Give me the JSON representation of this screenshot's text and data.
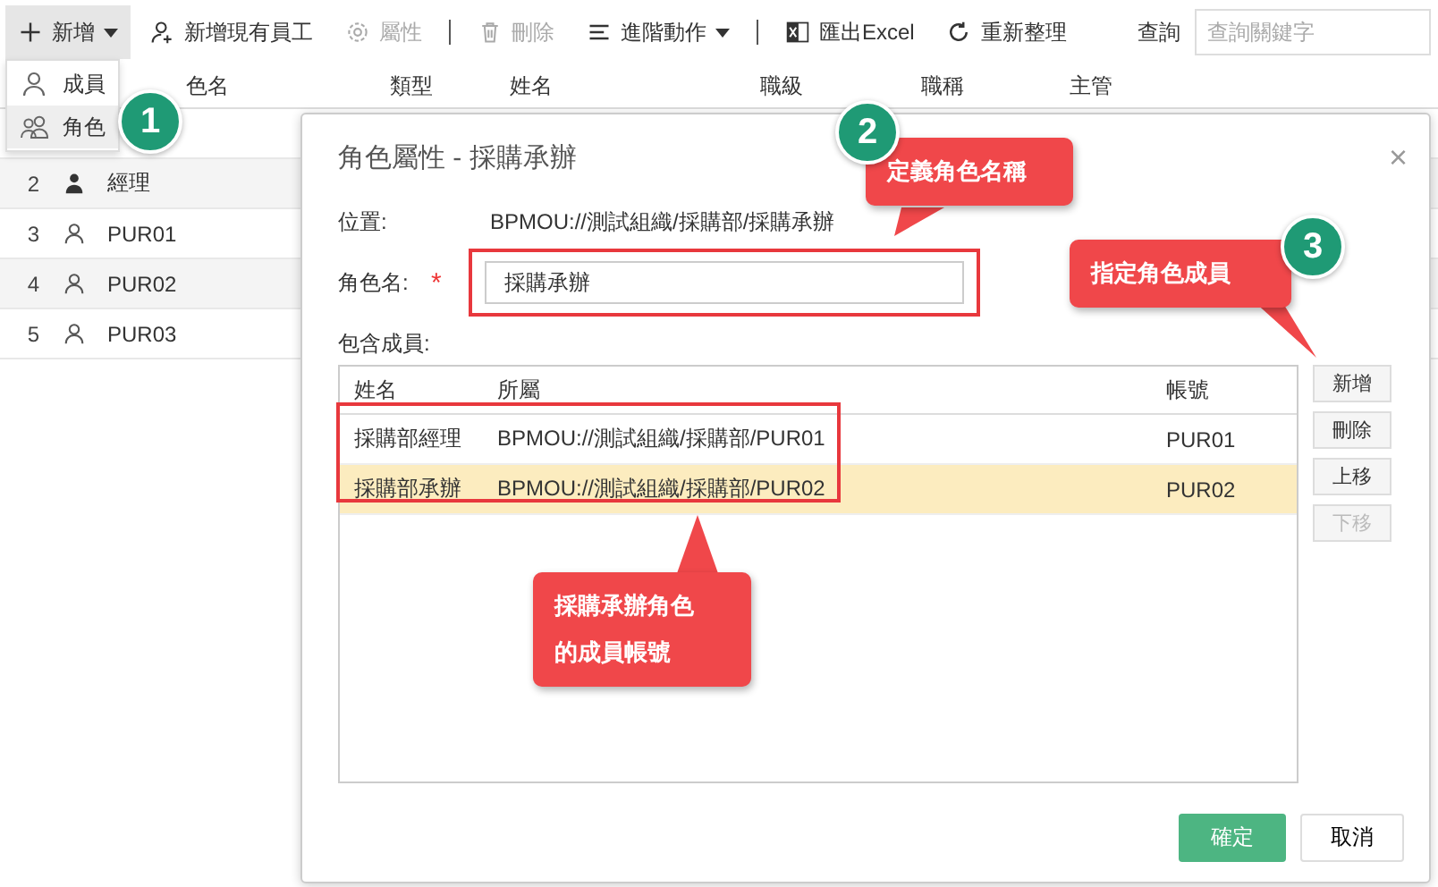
{
  "toolbar": {
    "items": [
      {
        "kind": "button",
        "label": "新增",
        "caret": true,
        "pressed": true,
        "disabled": false
      },
      {
        "kind": "button",
        "label": "新增現有員工",
        "caret": false,
        "pressed": false,
        "disabled": false
      },
      {
        "kind": "button",
        "label": "屬性",
        "caret": false,
        "pressed": false,
        "disabled": true
      },
      {
        "kind": "separator"
      },
      {
        "kind": "button",
        "label": "刪除",
        "caret": false,
        "pressed": false,
        "disabled": true
      },
      {
        "kind": "button",
        "label": "進階動作",
        "caret": true,
        "pressed": false,
        "disabled": false
      },
      {
        "kind": "separator"
      },
      {
        "kind": "button",
        "label": "匯出Excel",
        "caret": false,
        "pressed": false,
        "disabled": false
      },
      {
        "kind": "button",
        "label": "重新整理",
        "caret": false,
        "pressed": false,
        "disabled": false
      }
    ],
    "search_label": "查詢",
    "search": {
      "placeholder": "查詢關鍵字"
    }
  },
  "add_menu": {
    "items": [
      {
        "label": "成員",
        "selected": false
      },
      {
        "label": "角色",
        "selected": true
      }
    ]
  },
  "table": {
    "columns": [
      "色名",
      "類型",
      "姓名",
      "職級",
      "職稱",
      "主管"
    ],
    "rows": [
      {
        "number": "2",
        "kind": "manager",
        "name": "經理"
      },
      {
        "number": "3",
        "kind": "person",
        "name": "PUR01"
      },
      {
        "number": "4",
        "kind": "person",
        "name": "PUR02"
      },
      {
        "number": "5",
        "kind": "person",
        "name": "PUR03"
      }
    ]
  },
  "dialog": {
    "title": "角色屬性 - 採購承辦",
    "close": "×",
    "location_label": "位置:",
    "location": "BPMOU://測試組織/採購部/採購承辦",
    "name_label": "角色名:",
    "required_mark": "*",
    "name_value": "採購承辦",
    "members_label": "包含成員:",
    "members": {
      "columns": [
        "姓名",
        "所屬",
        "帳號"
      ],
      "rows": [
        {
          "name": "採購部經理",
          "path": "BPMOU://測試組織/採購部/PUR01",
          "account": "PUR01",
          "selected": false
        },
        {
          "name": "採購部承辦",
          "path": "BPMOU://測試組織/採購部/PUR02",
          "account": "PUR02",
          "selected": true
        }
      ]
    },
    "side_buttons": [
      {
        "label": "新增",
        "disabled": false
      },
      {
        "label": "刪除",
        "disabled": false
      },
      {
        "label": "上移",
        "disabled": false
      },
      {
        "label": "下移",
        "disabled": true
      }
    ],
    "ok": "確定",
    "cancel": "取消"
  },
  "annotations": {
    "badges": [
      "1",
      "2",
      "3"
    ],
    "callouts": [
      [
        "定義角色名稱"
      ],
      [
        "指定角色成員"
      ],
      [
        "採購承辦角色",
        "的成員帳號"
      ]
    ]
  }
}
